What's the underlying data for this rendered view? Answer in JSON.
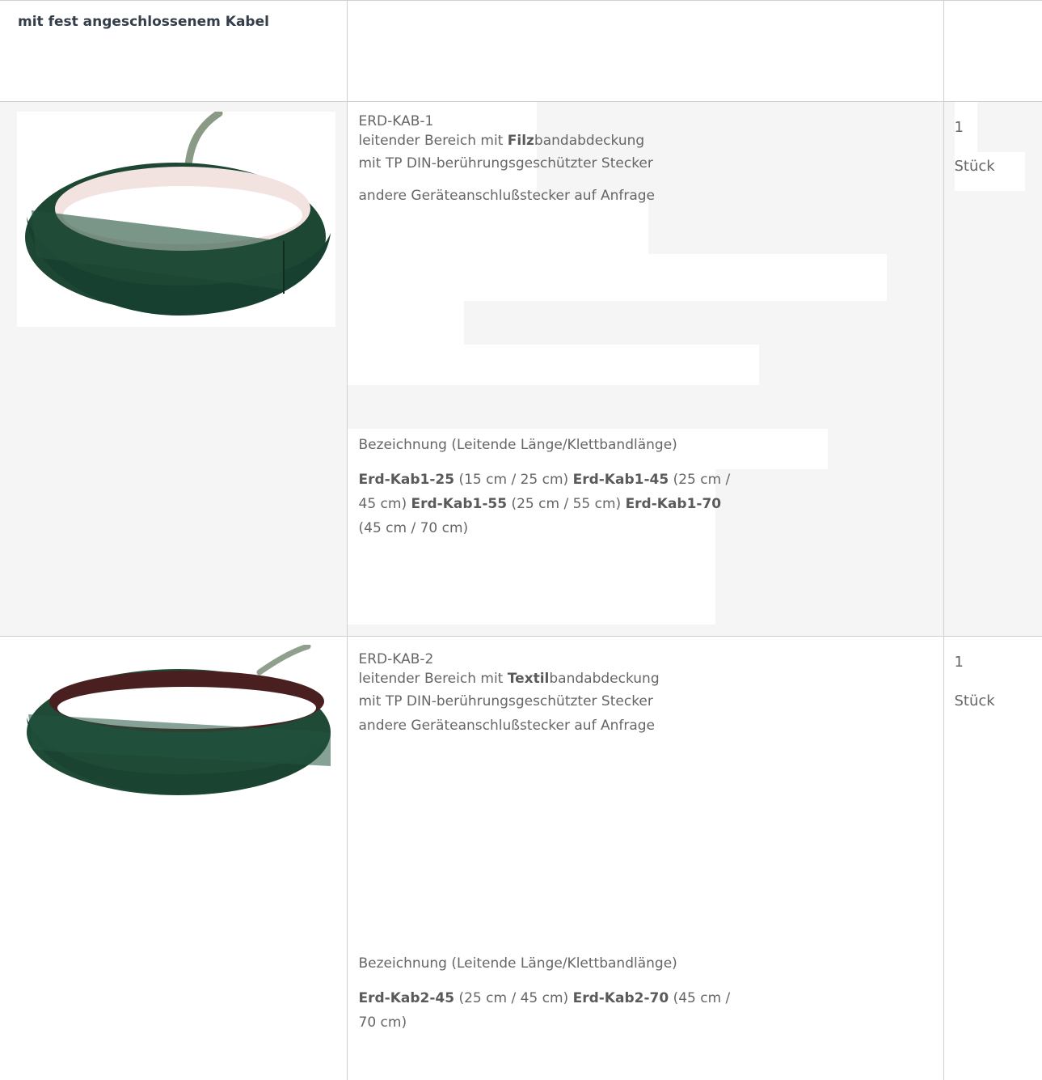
{
  "table": {
    "header": {
      "title": "mit fest angeschlossenem Kabel"
    },
    "products": [
      {
        "code": "ERD-KAB-1",
        "line1_prefix": "leitender Bereich mit ",
        "line1_bold": "Filz",
        "line1_suffix": "bandabdeckung",
        "line2": "mit TP DIN-berührungsgeschützter Stecker",
        "line3": "andere Geräteanschlußstecker auf Anfrage",
        "spec_heading": "Bezeichnung (Leitende Länge/Klettbandlänge)",
        "variants": [
          {
            "name": "Erd-Kab1-25",
            "dims": "(15 cm / 25 cm)"
          },
          {
            "name": "Erd-Kab1-45",
            "dims": "(25 cm / 45 cm)"
          },
          {
            "name": "Erd-Kab1-55",
            "dims": "(25 cm / 55 cm)"
          },
          {
            "name": "Erd-Kab1-70",
            "dims": "(45 cm / 70 cm)"
          }
        ],
        "qty_number": "1",
        "qty_unit": "Stück"
      },
      {
        "code": "ERD-KAB-2",
        "line1_prefix": "leitender Bereich mit ",
        "line1_bold": "Textil",
        "line1_suffix": "bandabdeckung",
        "line2": "mit TP DIN-berührungsgeschützter Stecker",
        "line3": "andere Geräteanschlußstecker auf Anfrage",
        "spec_heading": "Bezeichnung (Leitende Länge/Klettbandlänge)",
        "variants": [
          {
            "name": "Erd-Kab2-45",
            "dims": "(25 cm / 45 cm)"
          },
          {
            "name": "Erd-Kab2-70",
            "dims": "(45 cm / 70 cm)"
          }
        ],
        "qty_number": "1",
        "qty_unit": "Stück"
      }
    ]
  },
  "colors": {
    "header_text": "#333e48",
    "body_text": "#666666",
    "row_alt_bg": "#f5f5f5",
    "border": "#cfcfcf",
    "band_green": "#1f4a37"
  }
}
